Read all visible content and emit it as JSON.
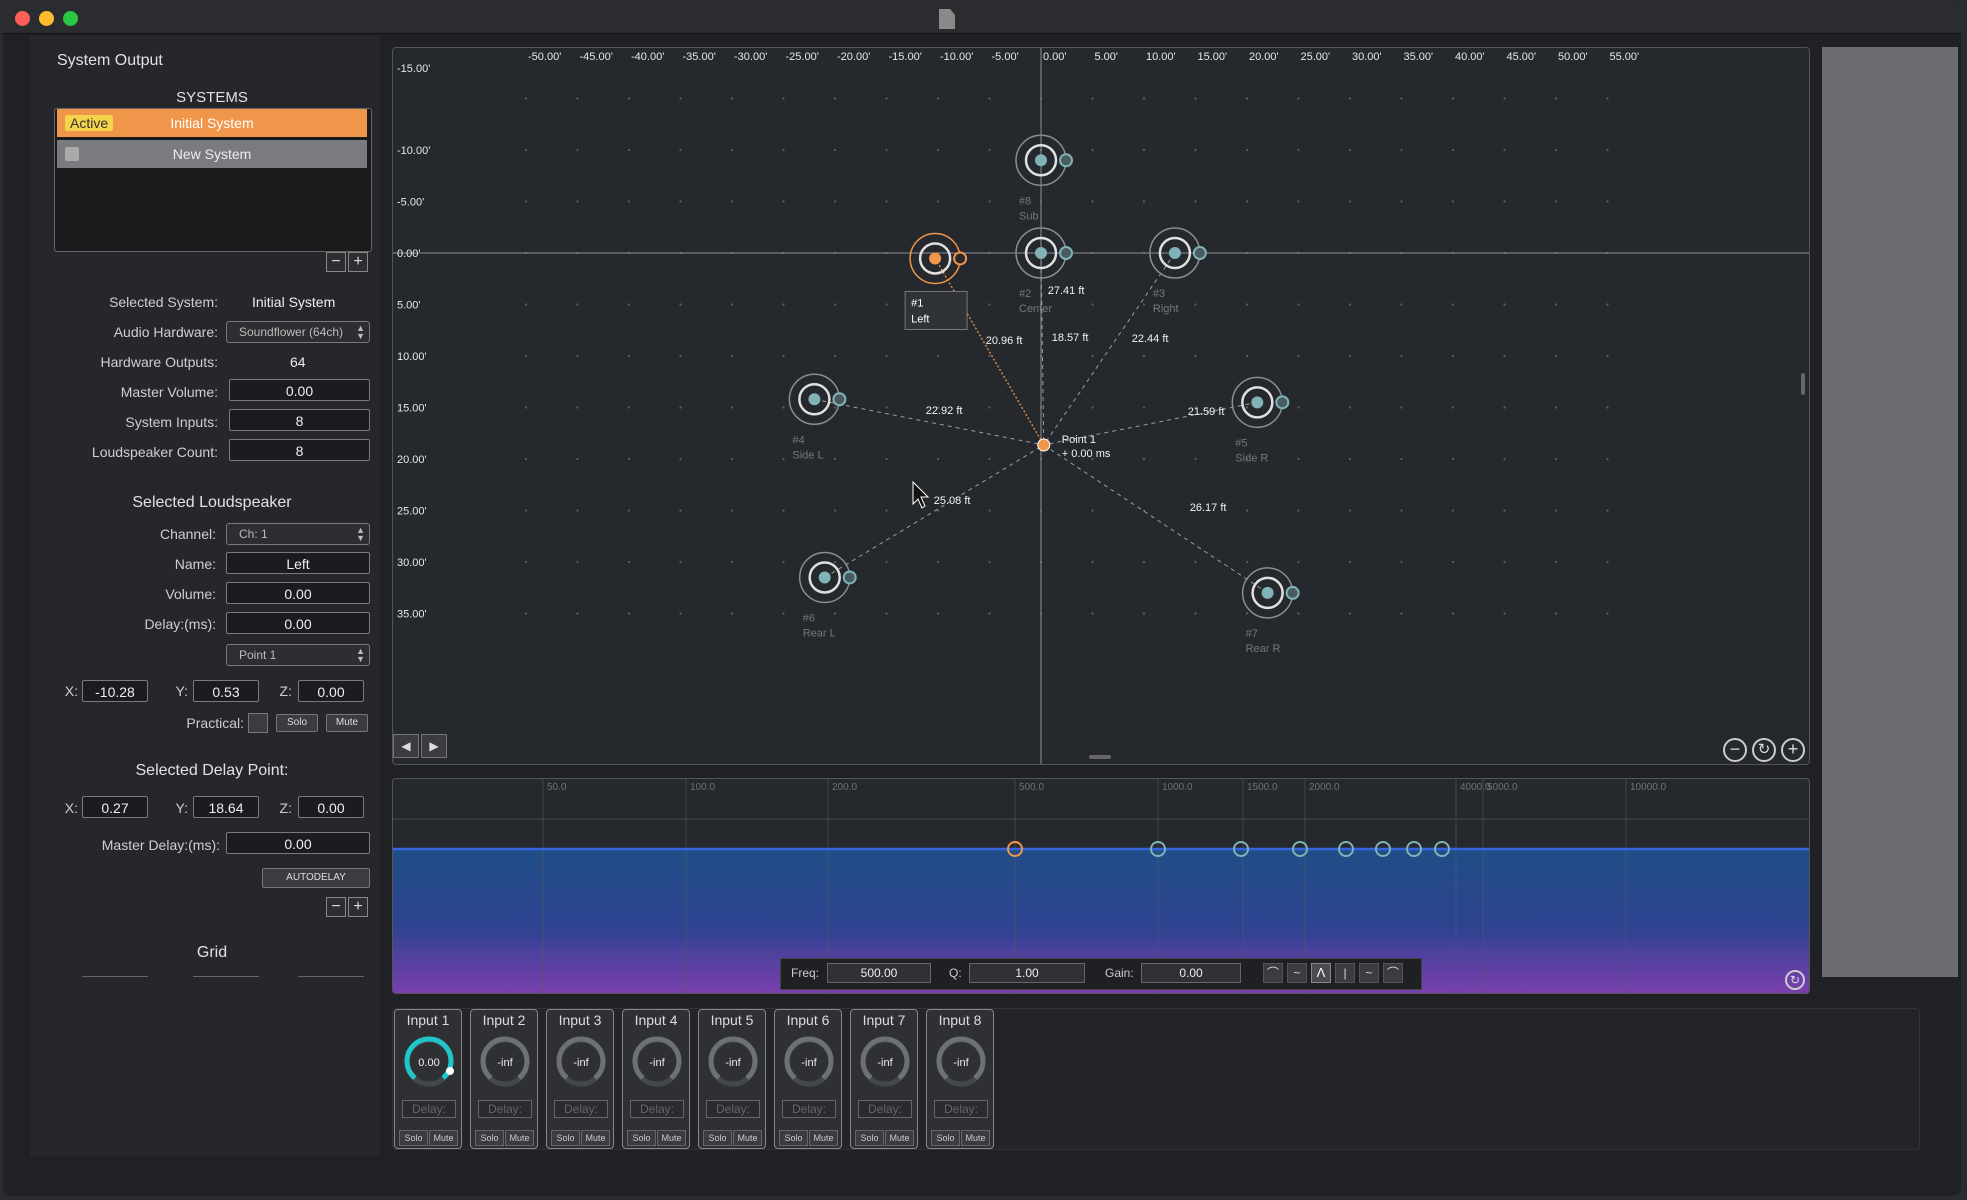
{
  "window": {
    "title_icon": "document-icon"
  },
  "left": {
    "header": "System Output",
    "systems_header": "SYSTEMS",
    "systems": [
      {
        "badge": "Active",
        "name": "Initial System"
      },
      {
        "badge": "",
        "name": "New System"
      }
    ],
    "selected_system_label": "Selected System:",
    "selected_system_value": "Initial System",
    "audio_hw_label": "Audio Hardware:",
    "audio_hw_value": "Soundflower (64ch)",
    "hw_outputs_label": "Hardware Outputs:",
    "hw_outputs_value": "64",
    "master_volume_label": "Master Volume:",
    "master_volume_value": "0.00",
    "system_inputs_label": "System Inputs:",
    "system_inputs_value": "8",
    "ls_count_label": "Loudspeaker Count:",
    "ls_count_value": "8",
    "selected_ls_header": "Selected Loudspeaker",
    "channel_label": "Channel:",
    "channel_value": "Ch: 1",
    "name_label": "Name:",
    "name_value": "Left",
    "volume_label": "Volume:",
    "volume_value": "0.00",
    "delay_label": "Delay:(ms):",
    "delay_value": "0.00",
    "point_select": "Point 1",
    "x_label": "X:",
    "x_value": "-10.28",
    "y_label": "Y:",
    "y_value": "0.53",
    "z_label": "Z:",
    "z_value": "0.00",
    "practical_label": "Practical:",
    "solo": "Solo",
    "mute": "Mute",
    "delay_point_header": "Selected Delay Point:",
    "dp_x": "0.27",
    "dp_y": "18.64",
    "dp_z": "0.00",
    "master_delay_label": "Master Delay:(ms):",
    "master_delay_value": "0.00",
    "autodelay": "AUTODELAY",
    "grid_header": "Grid"
  },
  "plot": {
    "top_ticks": [
      "-50.00'",
      "-45.00'",
      "-40.00'",
      "-35.00'",
      "-30.00'",
      "-25.00'",
      "-20.00'",
      "-15.00'",
      "-10.00'",
      "-5.00'",
      "0.00'",
      "5.00'",
      "10.00'",
      "15.00'",
      "20.00'",
      "25.00'",
      "30.00'",
      "35.00'",
      "40.00'",
      "45.00'",
      "50.00'",
      "55.00'"
    ],
    "left_ticks": [
      "-15.00'",
      "-10.00'",
      "-5.00'",
      "0.00'",
      "5.00'",
      "10.00'",
      "15.00'",
      "20.00'",
      "25.00'",
      "30.00'",
      "35.00'"
    ],
    "speakers": [
      {
        "id": "#1",
        "name": "Left",
        "selected": true
      },
      {
        "id": "#2",
        "name": "Center"
      },
      {
        "id": "#3",
        "name": "Right"
      },
      {
        "id": "#4",
        "name": "Side L"
      },
      {
        "id": "#5",
        "name": "Side R"
      },
      {
        "id": "#6",
        "name": "Rear L"
      },
      {
        "id": "#7",
        "name": "Rear R"
      },
      {
        "id": "#8",
        "name": "Sub"
      }
    ],
    "distances": [
      "20.96 ft",
      "18.57 ft",
      "22.44 ft",
      "27.41 ft",
      "22.92 ft",
      "21.59 ft",
      "25.08 ft",
      "26.17 ft"
    ],
    "point_label": "Point 1",
    "point_delay": "+ 0.00 ms"
  },
  "eq": {
    "freq_ticks": [
      "50.0",
      "100.0",
      "200.0",
      "500.0",
      "1000.0",
      "1500.0",
      "2000.0",
      "4000.0",
      "5000.0",
      "10000.0"
    ],
    "freq_label": "Freq:",
    "freq_value": "500.00",
    "q_label": "Q:",
    "q_value": "1.00",
    "gain_label": "Gain:",
    "gain_value": "0.00"
  },
  "inputs": [
    {
      "name": "Input 1",
      "level": "0.00",
      "delay": "Delay:",
      "active": true
    },
    {
      "name": "Input 2",
      "level": "-inf",
      "delay": "Delay:"
    },
    {
      "name": "Input 3",
      "level": "-inf",
      "delay": "Delay:"
    },
    {
      "name": "Input 4",
      "level": "-inf",
      "delay": "Delay:"
    },
    {
      "name": "Input 5",
      "level": "-inf",
      "delay": "Delay:"
    },
    {
      "name": "Input 6",
      "level": "-inf",
      "delay": "Delay:"
    },
    {
      "name": "Input 7",
      "level": "-inf",
      "delay": "Delay:"
    },
    {
      "name": "Input 8",
      "level": "-inf",
      "delay": "Delay:"
    }
  ],
  "colors": {
    "accent": "#f0964a",
    "speaker": "#7fb3b8",
    "knob_active": "#21c6c9",
    "eq_line": "#3566e0"
  }
}
